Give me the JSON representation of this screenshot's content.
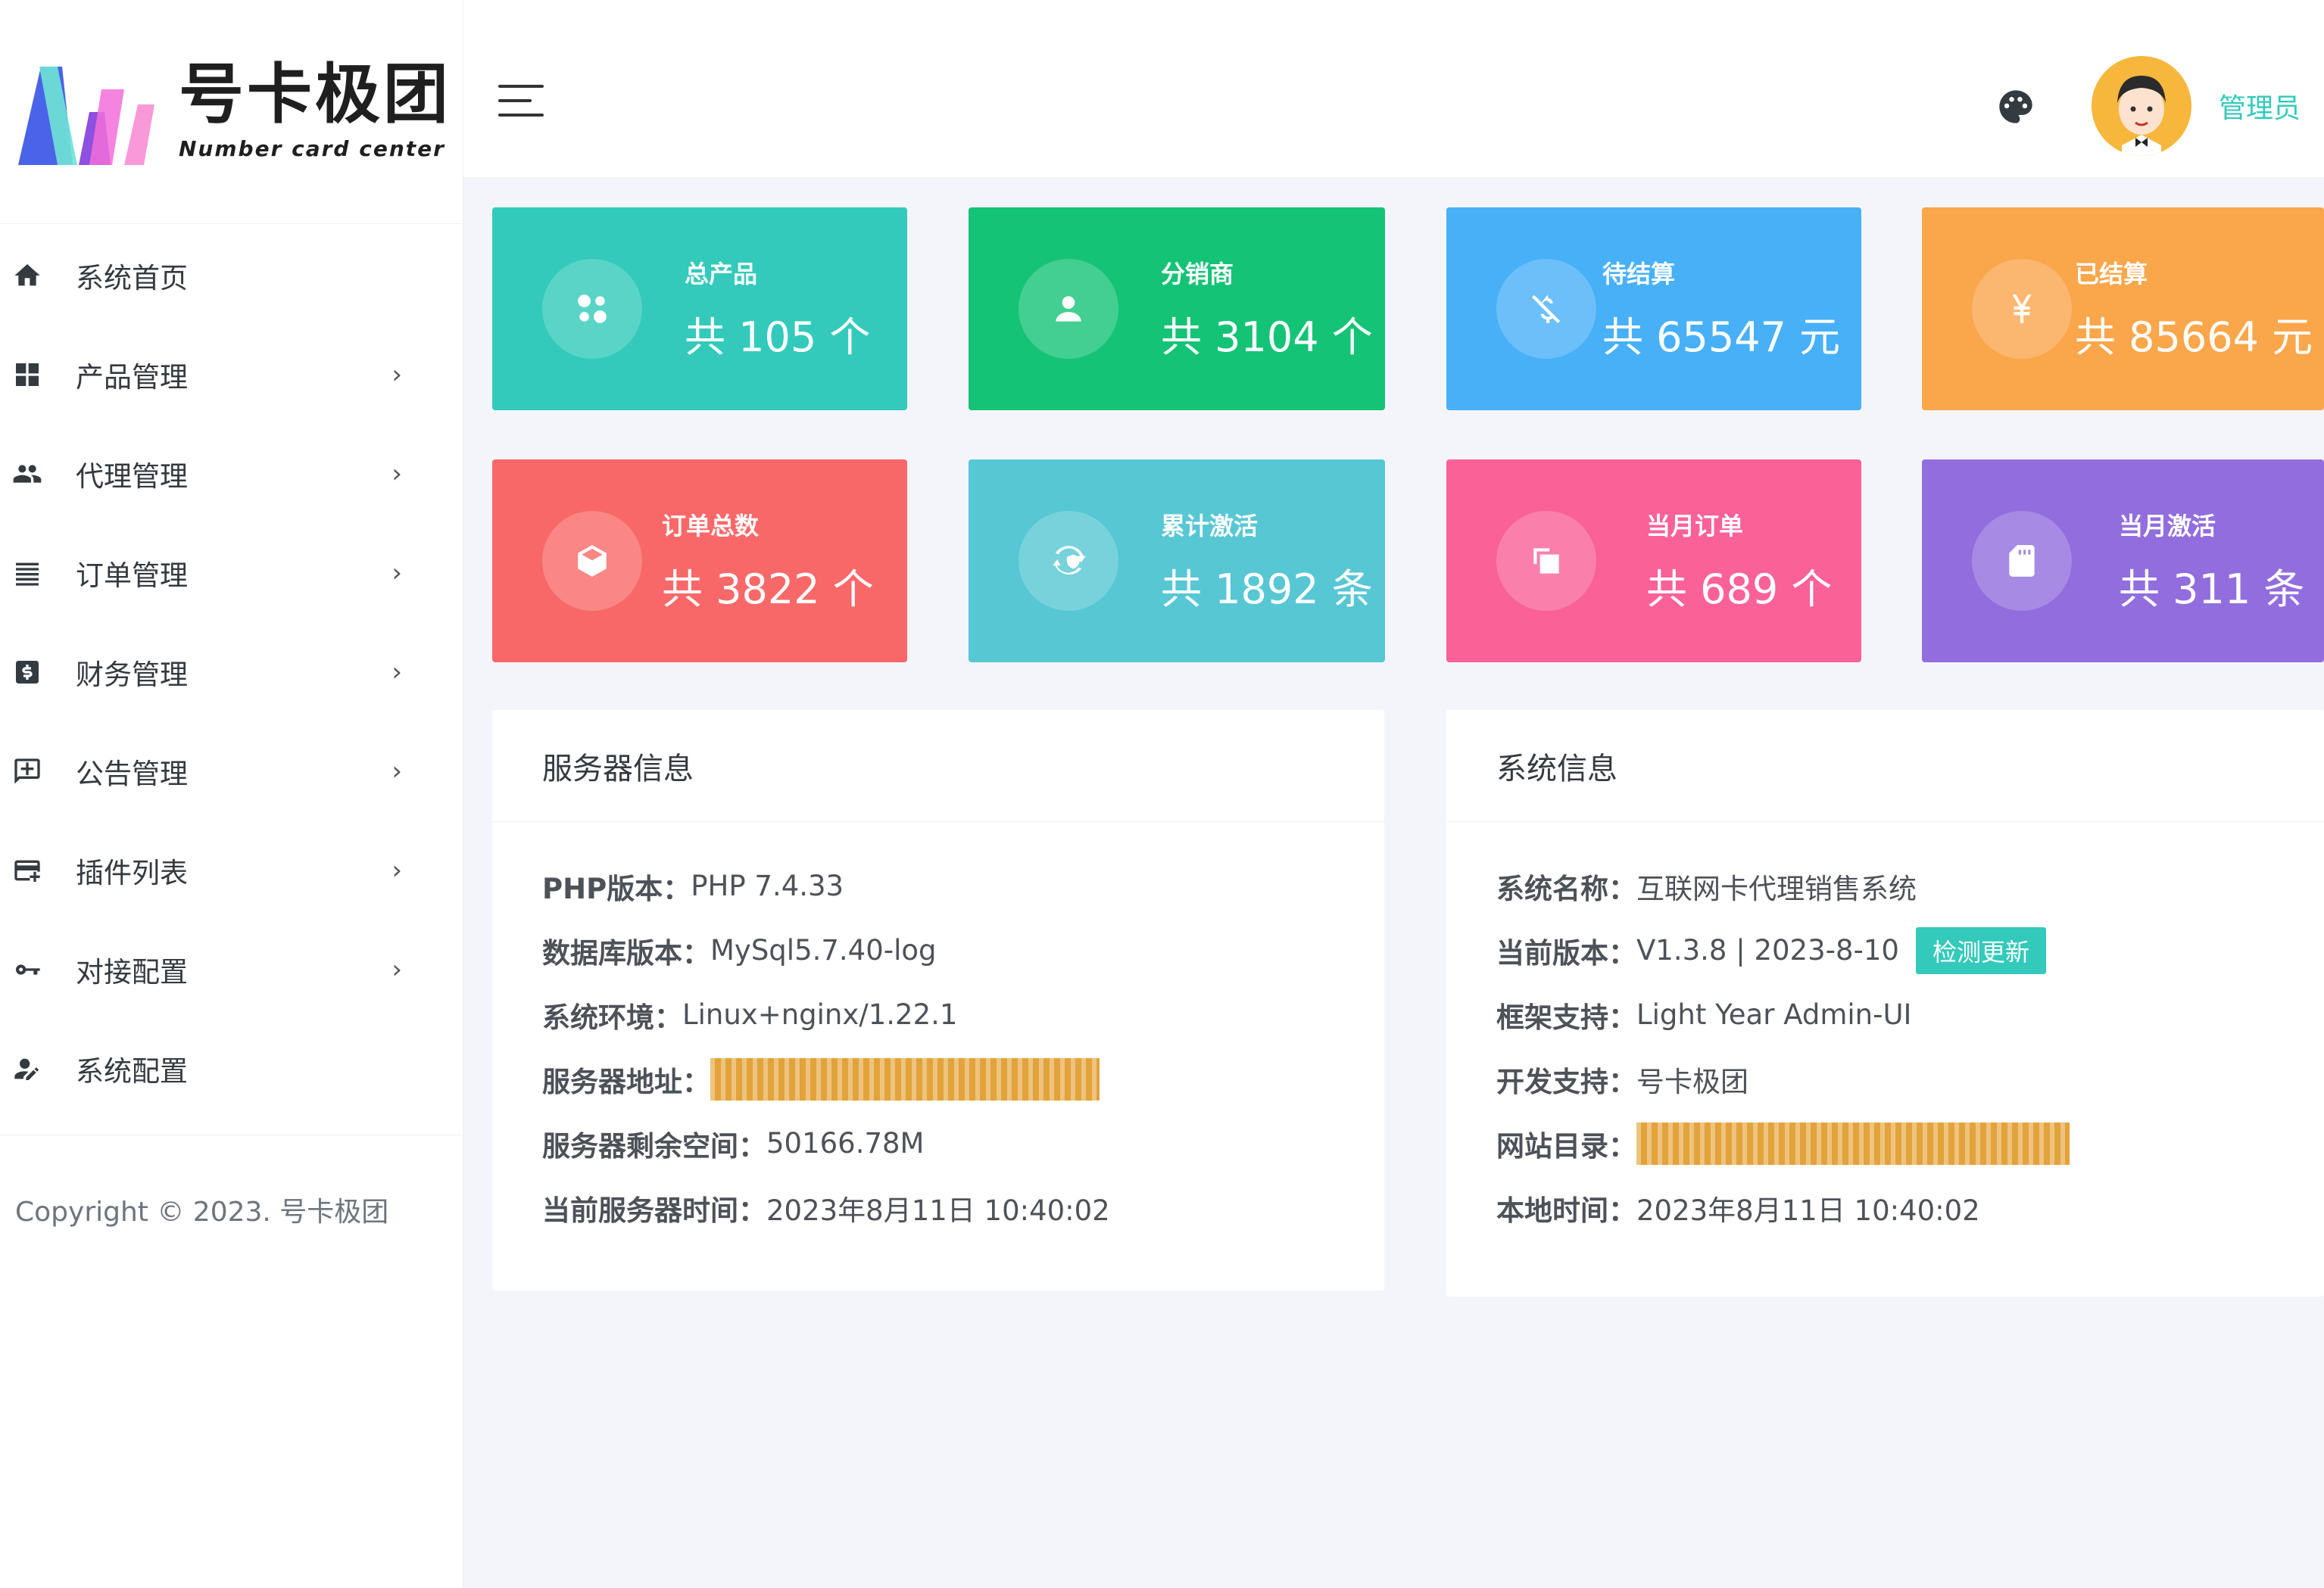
{
  "brand": {
    "name": "号卡极团",
    "subtitle": "Number card center"
  },
  "sidebar": {
    "items": [
      {
        "label": "系统首页",
        "icon": "home-icon",
        "arrow": ""
      },
      {
        "label": "产品管理",
        "icon": "grid-icon",
        "arrow": "›"
      },
      {
        "label": "代理管理",
        "icon": "users-icon",
        "arrow": "›"
      },
      {
        "label": "订单管理",
        "icon": "list-icon",
        "arrow": "›"
      },
      {
        "label": "财务管理",
        "icon": "dollar-box-icon",
        "arrow": "›"
      },
      {
        "label": "公告管理",
        "icon": "message-plus-icon",
        "arrow": "›"
      },
      {
        "label": "插件列表",
        "icon": "card-plus-icon",
        "arrow": "›"
      },
      {
        "label": "对接配置",
        "icon": "key-icon",
        "arrow": "›"
      },
      {
        "label": "系统配置",
        "icon": "user-edit-icon",
        "arrow": ""
      }
    ],
    "copyright": "Copyright © 2023. 号卡极团"
  },
  "header": {
    "user_name": "管理员",
    "theme_icon": "palette-icon",
    "menu_icon": "hamburger-icon"
  },
  "stats": [
    {
      "title": "总产品",
      "value": "共 105 个",
      "color": "#33cabb",
      "icon": "cluster-icon"
    },
    {
      "title": "分销商",
      "value": "共 3104 个",
      "color": "#15c377",
      "icon": "user-icon"
    },
    {
      "title": "待结算",
      "value": "共 65547 元",
      "color": "#48b0f7",
      "icon": "no-money-icon"
    },
    {
      "title": "已结算",
      "value": "共 85664 元",
      "color": "#faa64b",
      "icon": "yen-icon"
    },
    {
      "title": "订单总数",
      "value": "共 3822 个",
      "color": "#f96868",
      "icon": "box-icon"
    },
    {
      "title": "累计激活",
      "value": "共 1892 条",
      "color": "#57c7d4",
      "icon": "shield-refresh-icon"
    },
    {
      "title": "当月订单",
      "value": "共 689 个",
      "color": "#f96197",
      "icon": "copy-icon"
    },
    {
      "title": "当月激活",
      "value": "共 311 条",
      "color": "#926dde",
      "icon": "sd-card-icon"
    }
  ],
  "server_info": {
    "title": "服务器信息",
    "php_label": "PHP版本：",
    "php_value": "PHP 7.4.33",
    "db_label": "数据库版本：",
    "db_value": " MySql5.7.40-log",
    "env_label": "系统环境：",
    "env_value": "Linux+nginx/1.22.1",
    "addr_label": "服务器地址：",
    "space_label": "服务器剩余空间：",
    "space_value": "50166.78M",
    "time_label": "当前服务器时间：",
    "time_value": "2023年8月11日 10:40:02"
  },
  "system_info": {
    "title": "系统信息",
    "name_label": "系统名称：",
    "name_value": "互联网卡代理销售系统",
    "version_label": "当前版本：",
    "version_value": "V1.3.8 | 2023-8-10",
    "update_button": "检测更新",
    "framework_label": "框架支持：",
    "framework_value": "Light Year Admin-UI",
    "dev_label": "开发支持：",
    "dev_value": "号卡极团",
    "dir_label": "网站目录：",
    "local_time_label": "本地时间：",
    "local_time_value": "2023年8月11日 10:40:02"
  }
}
